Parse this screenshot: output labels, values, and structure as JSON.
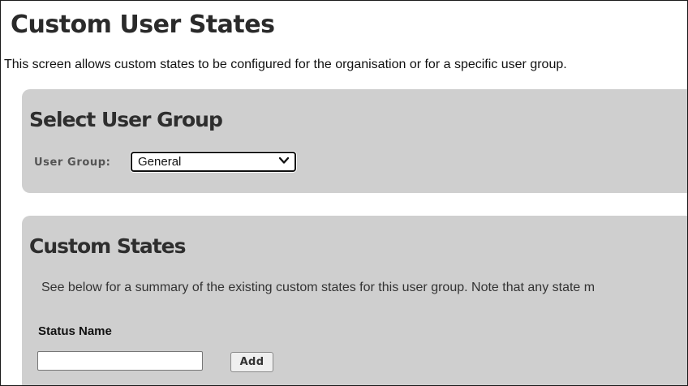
{
  "page": {
    "title": "Custom User States",
    "intro": "This screen allows custom states to be configured for the organisation or for a specific user group."
  },
  "select_group": {
    "heading": "Select User Group",
    "label": "User Group:",
    "selected": "General"
  },
  "custom_states": {
    "heading": "Custom States",
    "description": "See below for a summary of the existing custom states for this user group. Note that any state m",
    "status_name_label": "Status Name",
    "status_name_value": "",
    "add_label": "Add"
  },
  "icons": {
    "select_caret": "chevron-down-icon"
  }
}
